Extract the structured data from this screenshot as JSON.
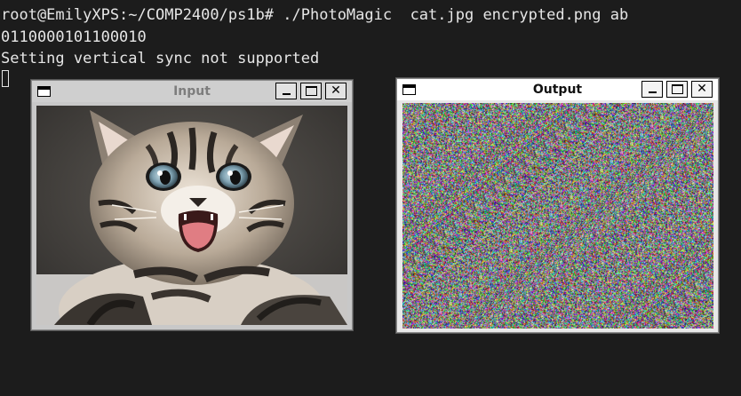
{
  "terminal": {
    "lines": [
      "root@EmilyXPS:~/COMP2400/ps1b# ./PhotoMagic  cat.jpg encrypted.png ab",
      "0110000101100010",
      "Setting vertical sync not supported"
    ],
    "colors": {
      "background": "#1c1c1c",
      "text": "#e6e6e6"
    }
  },
  "windows": {
    "input": {
      "title": "Input"
    },
    "output": {
      "title": "Output"
    }
  },
  "controls": {
    "close_glyph": "✕"
  },
  "icons": {
    "system_menu": "window-menu-icon",
    "minimize": "minimize-icon",
    "maximize": "maximize-icon",
    "close": "close-icon"
  }
}
